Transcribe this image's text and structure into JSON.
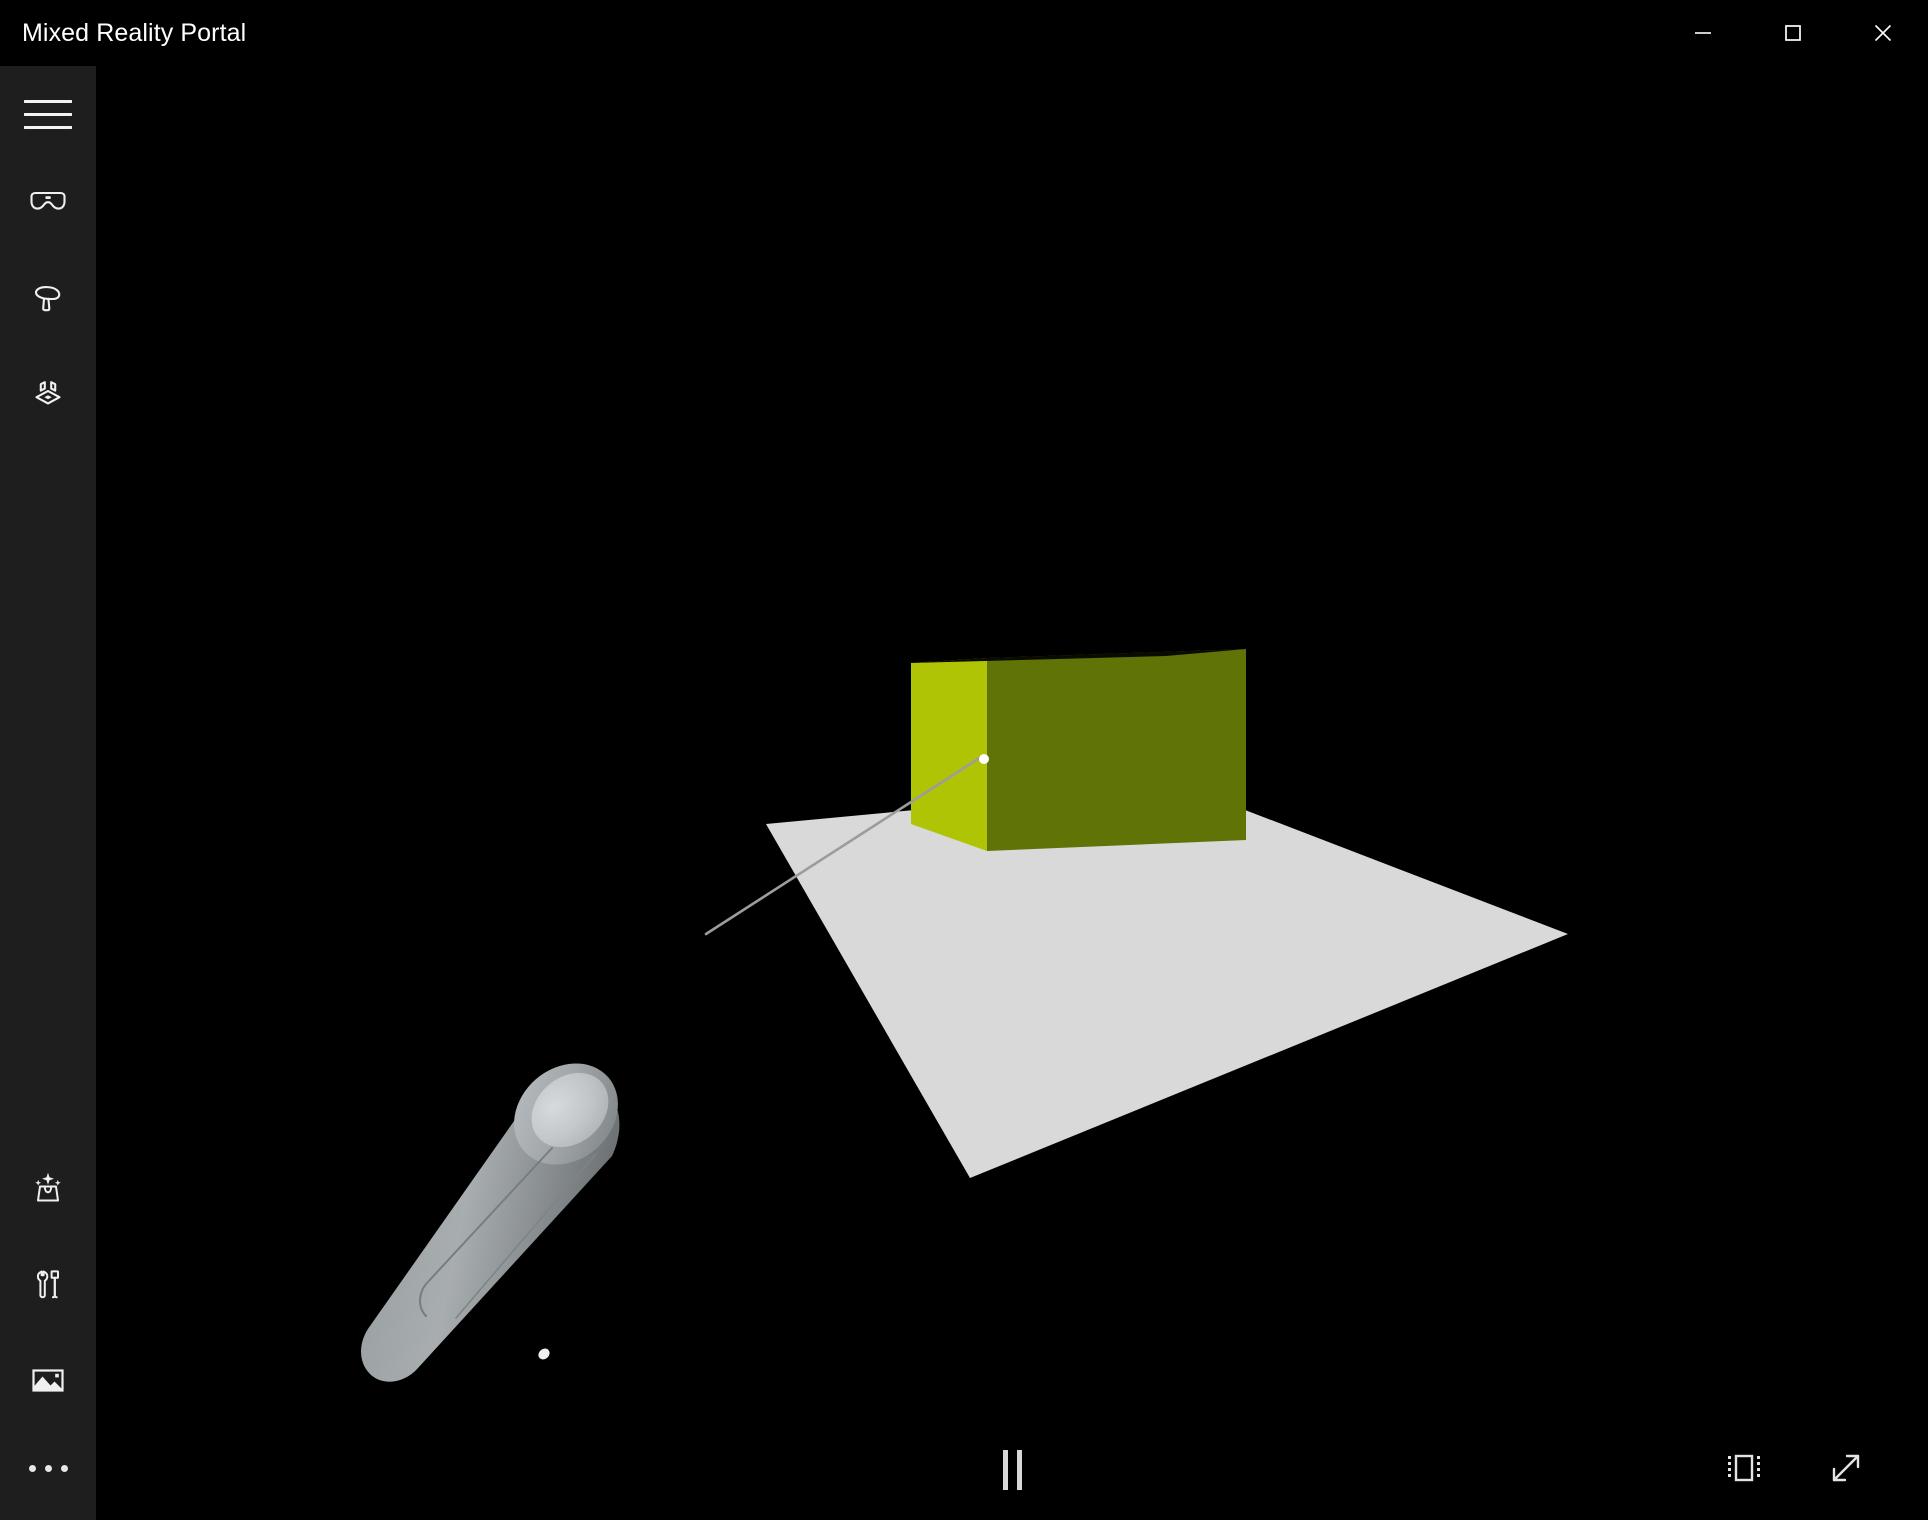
{
  "window": {
    "title": "Mixed Reality Portal",
    "controls": [
      {
        "name": "minimize",
        "label": "Minimize",
        "glyph": "minimize-icon"
      },
      {
        "name": "maximize",
        "label": "Maximize",
        "glyph": "maximize-icon"
      },
      {
        "name": "close",
        "label": "Close",
        "glyph": "close-icon"
      }
    ]
  },
  "colors": {
    "app_background": "#000000",
    "sidebar_background": "#1e1e1e",
    "icon_stroke": "#f0f0f0",
    "title_text": "#ffffff",
    "cube_left_face": "#b0c406",
    "cube_right_face": "#5f7306",
    "cube_top_face": "#000000",
    "floor_plane": "#d9d9d9",
    "pointer_ray": "#9a9a9a",
    "cursor_dot": "#ffffff",
    "controller_body": "#8f9396",
    "controller_highlight": "#c3c7ca",
    "controller_shadow": "#6e7376",
    "playback_control": "#d8d8d8"
  },
  "sidebar": {
    "menu": {
      "label": "Menu",
      "icon": "hamburger-menu-icon"
    },
    "items_top": [
      {
        "label": "Headset display",
        "icon": "vr-headset-icon"
      },
      {
        "label": "Motion controllers",
        "icon": "motion-controller-icon"
      },
      {
        "label": "Set up boundary",
        "icon": "room-boundary-icon"
      }
    ],
    "items_bottom": [
      {
        "label": "Store",
        "icon": "store-bag-sparkle-icon"
      },
      {
        "label": "Tools",
        "icon": "wrench-screwdriver-icon"
      },
      {
        "label": "Photos",
        "icon": "picture-icon"
      }
    ],
    "more": {
      "label": "More",
      "icon": "ellipsis-icon"
    }
  },
  "viewport": {
    "label": "Mixed reality preview",
    "scene": {
      "description": "3D mixed reality preview showing a motion controller pointing a ray at a yellow-green cube resting on a light gray floor plane",
      "objects": [
        {
          "name": "cube",
          "type": "box",
          "color_left": "#b0c406",
          "color_right": "#5f7306"
        },
        {
          "name": "floor-plane",
          "type": "quad",
          "color": "#d9d9d9"
        },
        {
          "name": "motion-controller",
          "type": "model",
          "color": "#8f9396"
        },
        {
          "name": "pointer-ray",
          "type": "line",
          "color": "#9a9a9a"
        },
        {
          "name": "cursor-dot",
          "type": "point",
          "color": "#ffffff"
        }
      ]
    }
  },
  "playback": {
    "pause": {
      "label": "Pause",
      "icon": "pause-icon",
      "state": "playing"
    },
    "fit_view": {
      "label": "Fit to window",
      "icon": "fit-to-window-icon"
    },
    "fullscreen": {
      "label": "Full screen",
      "icon": "fullscreen-expand-icon"
    }
  }
}
